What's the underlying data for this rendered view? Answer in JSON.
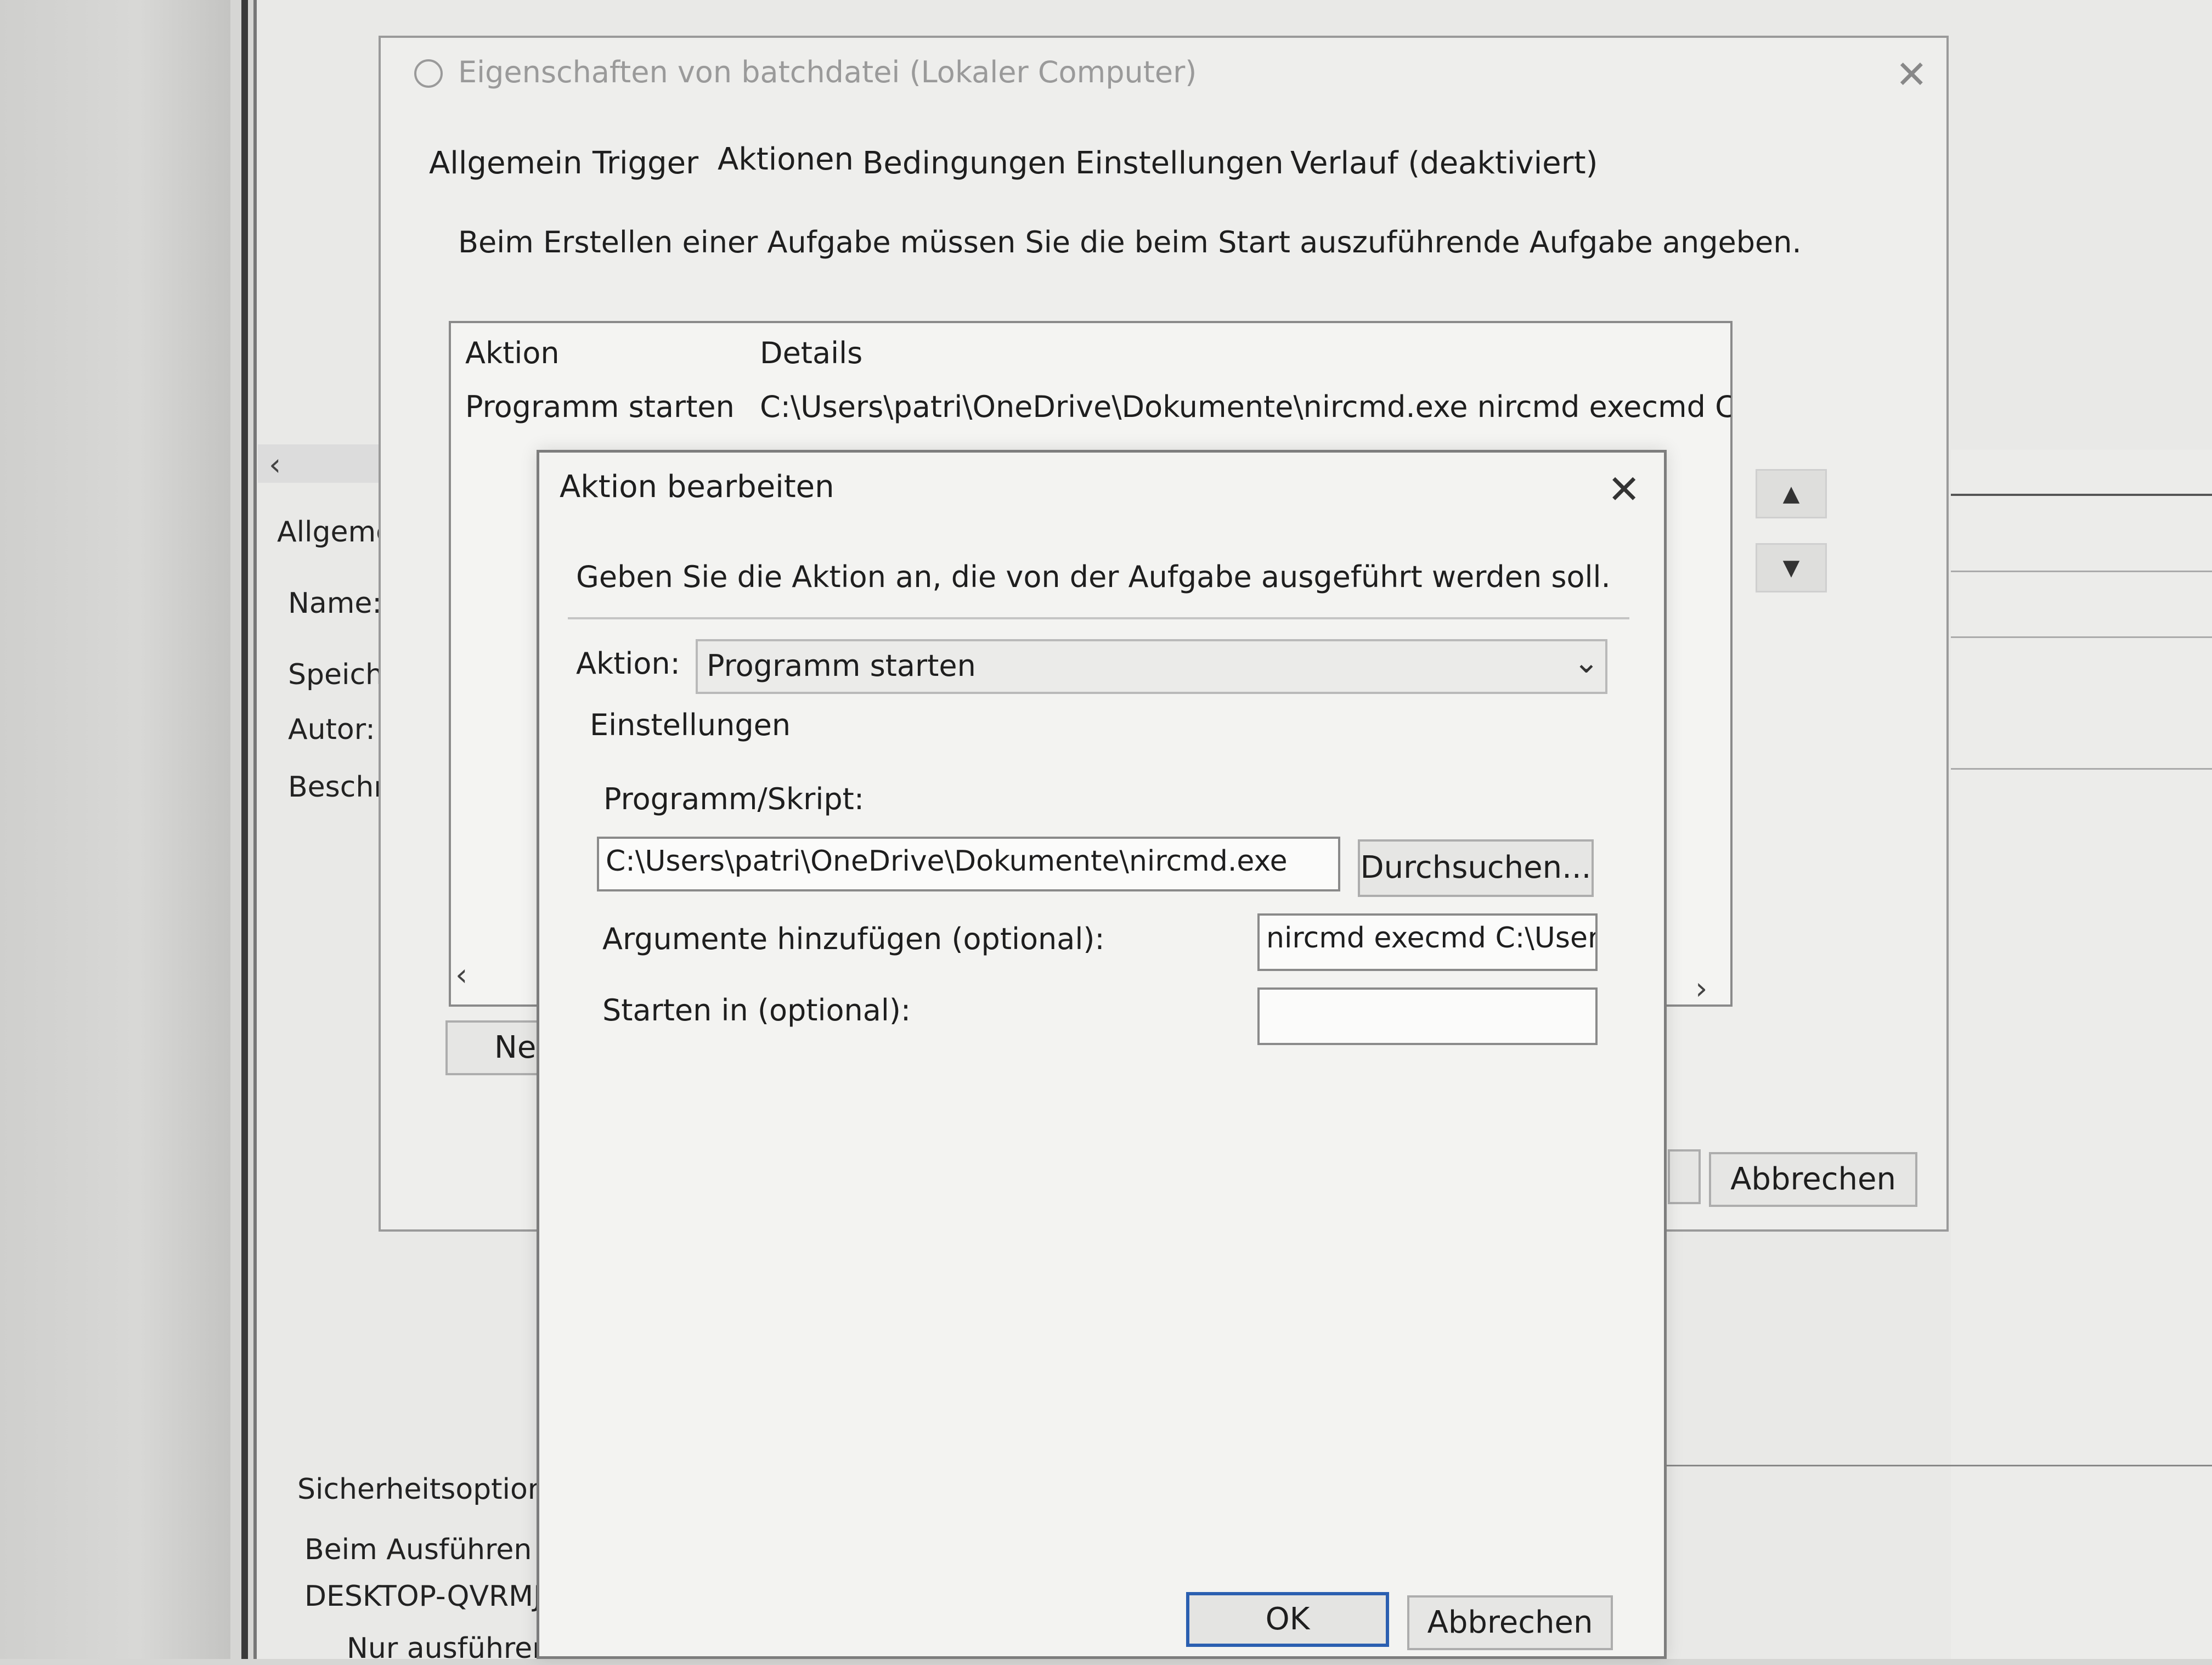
{
  "background": {
    "panel_labels": [
      "Allgeme",
      "Name:",
      "Speiche",
      "Autor:",
      "Beschre",
      "Sicherheitsoptione",
      "Beim Ausführen d",
      "DESKTOP-QVRMJ",
      "Nur ausführen"
    ]
  },
  "properties_dialog": {
    "title": "Eigenschaften von batchdatei (Lokaler Computer)",
    "tabs": [
      "Allgemein",
      "Trigger",
      "Aktionen",
      "Bedingungen",
      "Einstellungen",
      "Verlauf (deaktiviert)"
    ],
    "hint": "Beim Erstellen einer Aufgabe müssen Sie die beim Start auszuführende Aufgabe angeben.",
    "list": {
      "columns": [
        "Aktion",
        "Details"
      ],
      "rows": [
        {
          "action": "Programm starten",
          "details": "C:\\Users\\patri\\OneDrive\\Dokumente\\nircmd.exe nircmd execmd C:\\User"
        }
      ]
    },
    "new_button_partial": "Ne",
    "cancel_label": "Abbrechen"
  },
  "edit_dialog": {
    "title": "Aktion bearbeiten",
    "hint": "Geben Sie die Aktion an, die von der Aufgabe ausgeführt werden soll.",
    "action_label": "Aktion:",
    "action_value": "Programm starten",
    "settings_label": "Einstellungen",
    "program_label": "Programm/Skript:",
    "program_value": "C:\\Users\\patri\\OneDrive\\Dokumente\\nircmd.exe",
    "browse_label": "Durchsuchen...",
    "args_label": "Argumente hinzufügen (optional):",
    "args_value": "nircmd execmd C:\\Users",
    "startin_label": "Starten in (optional):",
    "startin_value": "",
    "ok_label": "OK",
    "cancel_label": "Abbrechen"
  }
}
